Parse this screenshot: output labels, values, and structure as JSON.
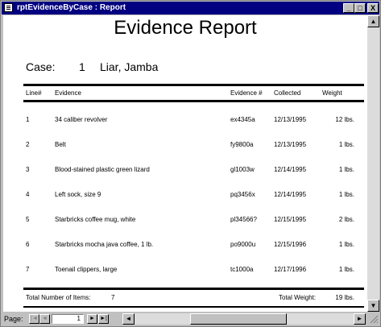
{
  "window": {
    "title": "rptEvidenceByCase : Report",
    "min_label": "_",
    "max_label": "□",
    "close_label": "X"
  },
  "report": {
    "title": "Evidence Report",
    "case_label": "Case:",
    "case_number": "1",
    "case_name": "Liar, Jamba",
    "columns": {
      "line": "Line#",
      "evidence": "Evidence",
      "evidence_no": "Evidence #",
      "collected": "Collected",
      "weight": "Weight"
    },
    "rows": [
      {
        "line": "1",
        "evidence": "34 caliber revolver",
        "evidence_no": "ex4345a",
        "collected": "12/13/1995",
        "weight": "12 lbs."
      },
      {
        "line": "2",
        "evidence": "Belt",
        "evidence_no": "fy9800a",
        "collected": "12/13/1995",
        "weight": "1 lbs."
      },
      {
        "line": "3",
        "evidence": "Blood-stained plastic green lizard",
        "evidence_no": "gl1003w",
        "collected": "12/14/1995",
        "weight": "1 lbs."
      },
      {
        "line": "4",
        "evidence": "Left sock, size 9",
        "evidence_no": "pq3456x",
        "collected": "12/14/1995",
        "weight": "1 lbs."
      },
      {
        "line": "5",
        "evidence": "Starbricks coffee mug, white",
        "evidence_no": "pl34566?",
        "collected": "12/15/1995",
        "weight": "2 lbs."
      },
      {
        "line": "6",
        "evidence": "Starbricks mocha java coffee, 1 lb.",
        "evidence_no": "po9000u",
        "collected": "12/15/1996",
        "weight": "1 lbs."
      },
      {
        "line": "7",
        "evidence": "Toenail clippers, large",
        "evidence_no": "tc1000a",
        "collected": "12/17/1996",
        "weight": "1 lbs."
      }
    ],
    "footer": {
      "total_items_label": "Total Number of Items:",
      "total_items": "7",
      "total_weight_label": "Total Weight:",
      "total_weight": "19 lbs."
    }
  },
  "navigation": {
    "page_label": "Page:",
    "page_value": "1",
    "first": "|◄",
    "prev": "◄",
    "next": "►",
    "last": "►|"
  },
  "scroll": {
    "up": "▲",
    "down": "▼",
    "left": "◄",
    "right": "►"
  }
}
